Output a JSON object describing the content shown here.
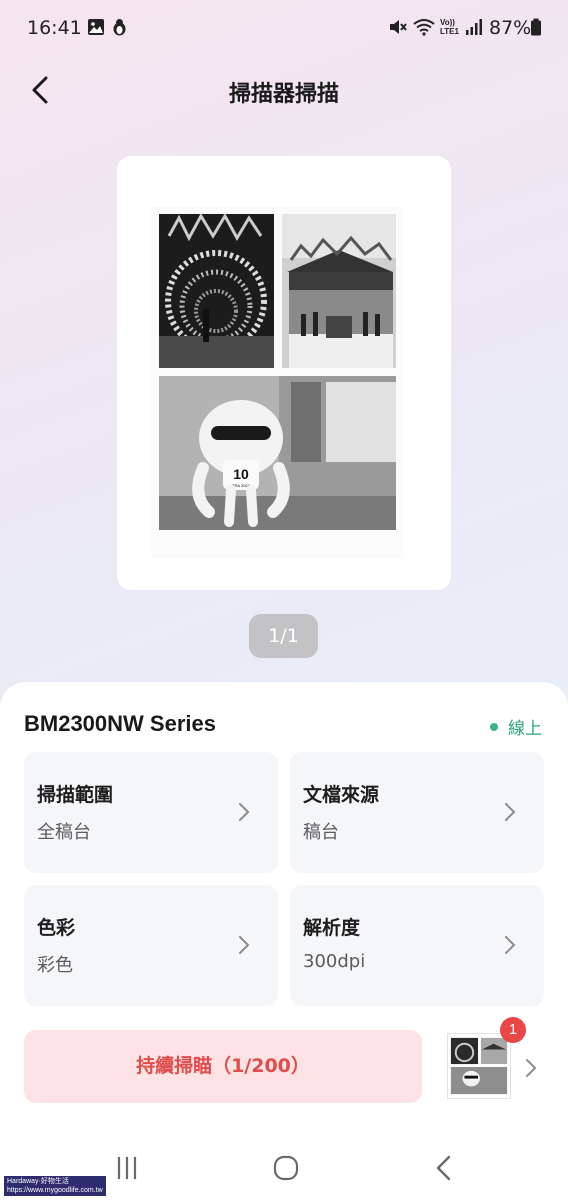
{
  "status_bar": {
    "time": "16:41",
    "battery": "87%",
    "icons": [
      "image-icon",
      "penguin-icon",
      "mute-icon",
      "wifi-icon",
      "volte-icon",
      "signal-icon",
      "battery-icon"
    ],
    "volte_top": "Vo))",
    "volte_bottom": "LTE1"
  },
  "header": {
    "title": "掃描器掃描",
    "back_icon": "chevron-left-icon"
  },
  "preview": {
    "page_indicator": "1/1",
    "badge_text": "10",
    "badge_small": "TRA 2024"
  },
  "device": {
    "name": "BM2300NW Series",
    "status": "線上",
    "status_color": "#2ea681"
  },
  "settings": [
    {
      "label": "掃描範圍",
      "value": "全稿台"
    },
    {
      "label": "文檔來源",
      "value": "稿台"
    },
    {
      "label": "色彩",
      "value": "彩色"
    },
    {
      "label": "解析度",
      "value": "300dpi"
    }
  ],
  "actions": {
    "continuous_scan": "持續掃瞄（1/200）",
    "scan_count_badge": "1",
    "accent_color": "#e04d4d"
  },
  "watermark": {
    "line1": "Hardaway·好物生活",
    "line2": "https://www.mygoodlife.com.tw"
  }
}
